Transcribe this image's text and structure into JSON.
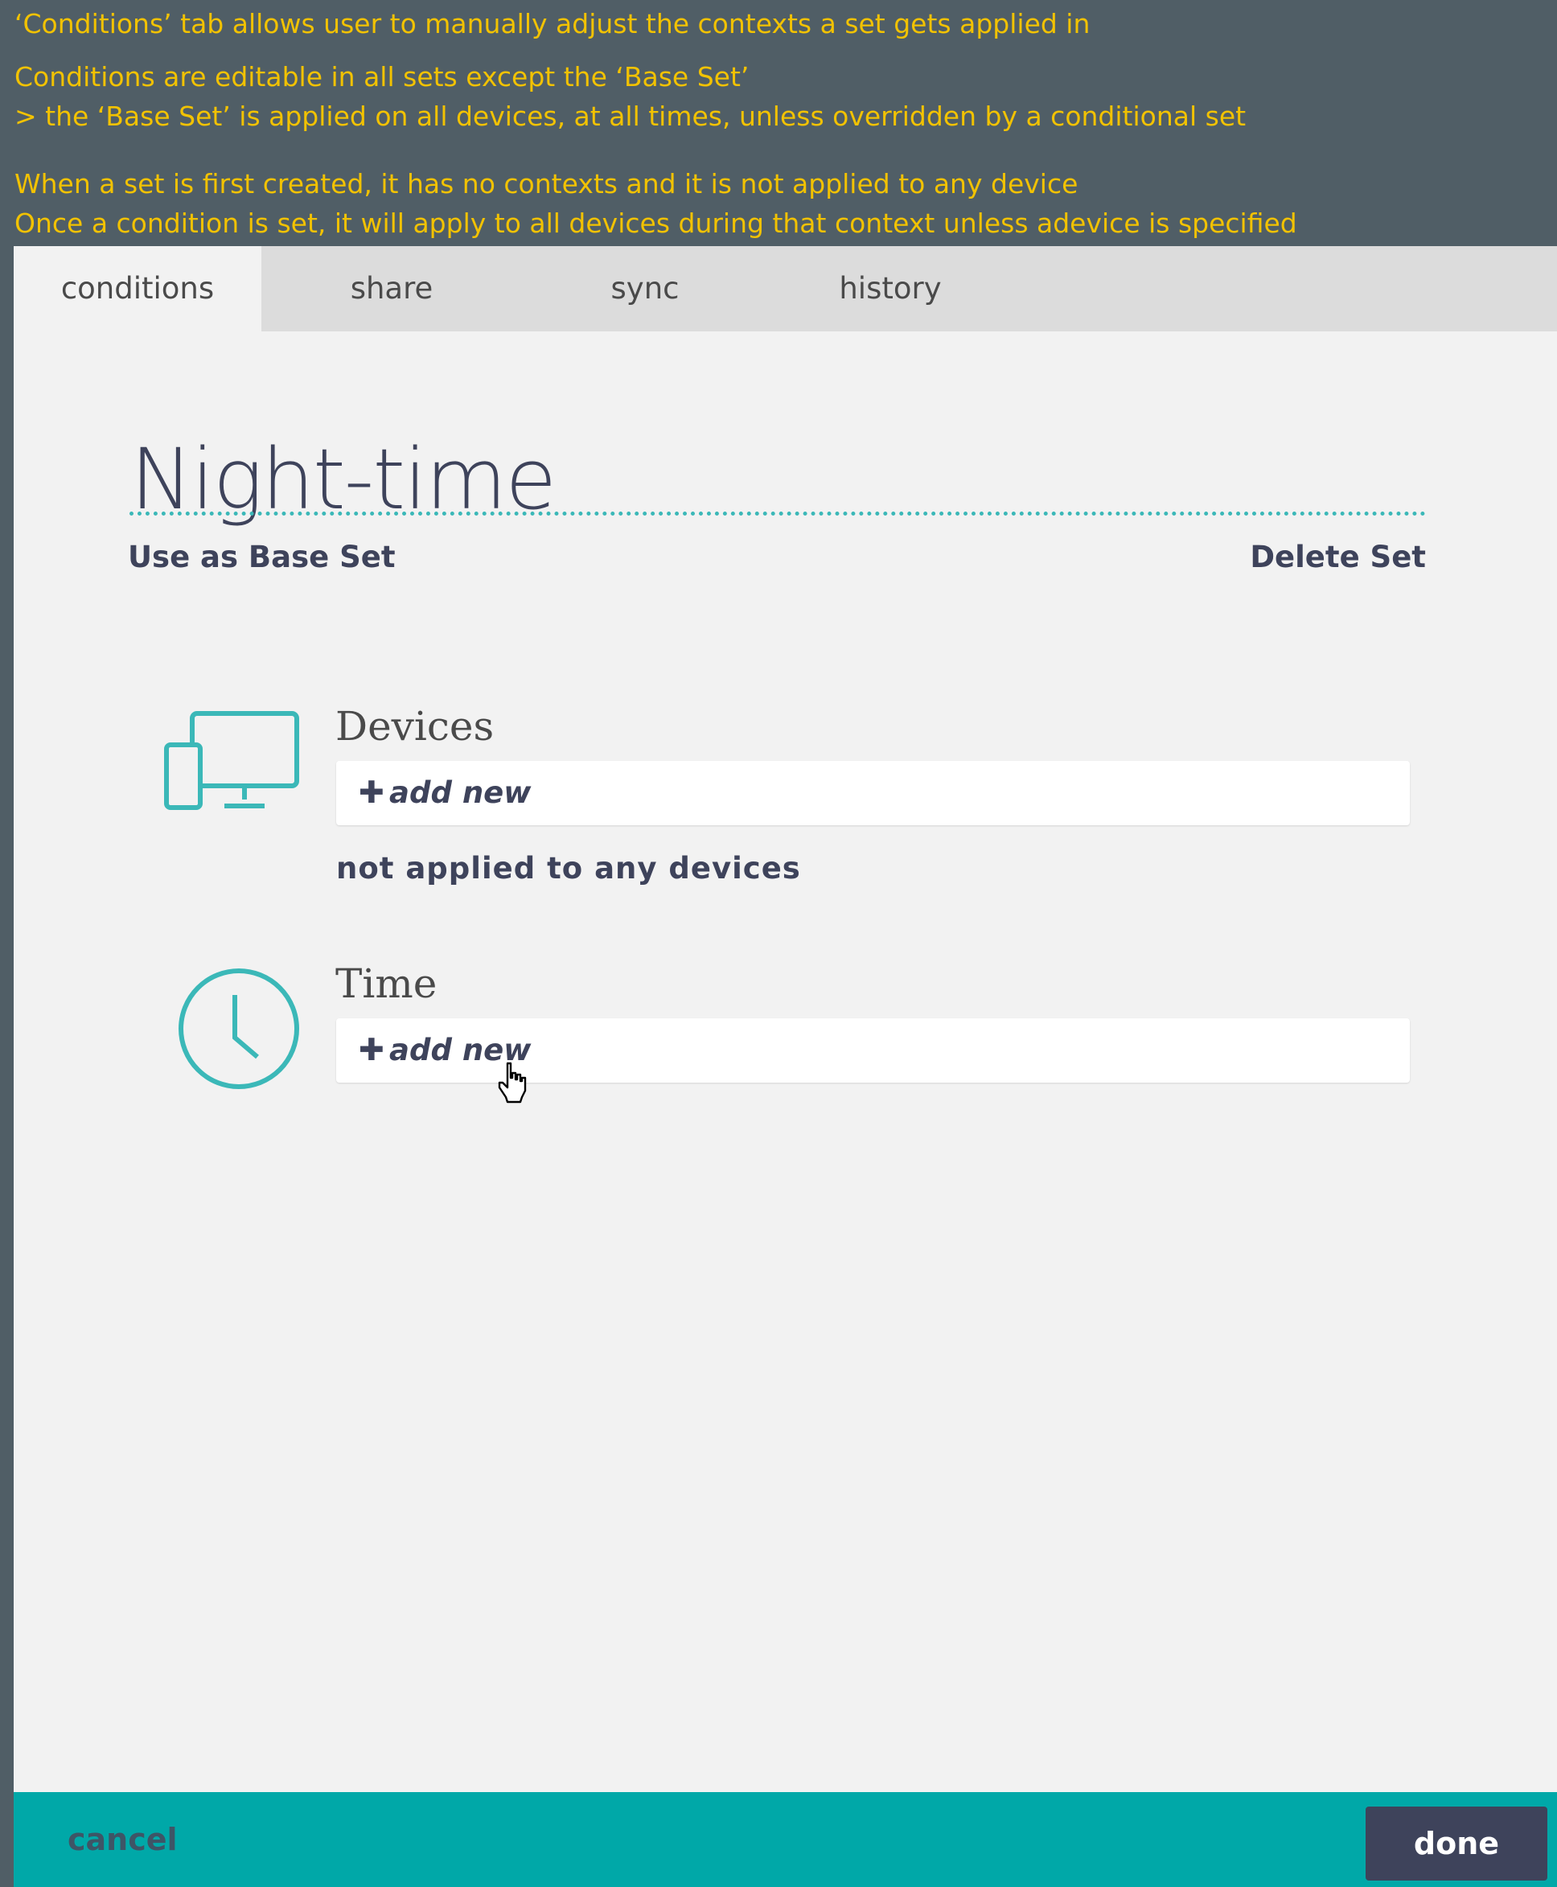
{
  "notes": [
    "‘Conditions’ tab allows user to manually adjust the contexts a set gets applied in",
    "Conditions are editable in all sets except the ‘Base Set’",
    "> the ‘Base Set’ is applied on all devices, at all times, unless overridden by a conditional set",
    "When a set is first created, it has no contexts and it is not applied to any device",
    "Once a condition is set, it will apply to all devices during that context unless adevice is specified"
  ],
  "tabs": [
    {
      "label": "conditions",
      "active": true
    },
    {
      "label": "share",
      "active": false
    },
    {
      "label": "sync",
      "active": false
    },
    {
      "label": "history",
      "active": false
    }
  ],
  "set": {
    "name": "Night-time",
    "use_as_base_label": "Use as Base Set",
    "delete_label": "Delete Set"
  },
  "devices": {
    "title": "Devices",
    "add_plus": "✚",
    "add_label": "add new",
    "status": "not applied to any devices",
    "icon": "devices-icon"
  },
  "time": {
    "title": "Time",
    "add_plus": "✚",
    "add_label": "add new",
    "icon": "clock-icon"
  },
  "footer": {
    "cancel_label": "cancel",
    "done_label": "done"
  },
  "colors": {
    "annotation": "#f2c200",
    "accent": "#3bb8b8",
    "footer": "#00a8a8",
    "dark": "#3e435b",
    "background": "#505e66"
  }
}
